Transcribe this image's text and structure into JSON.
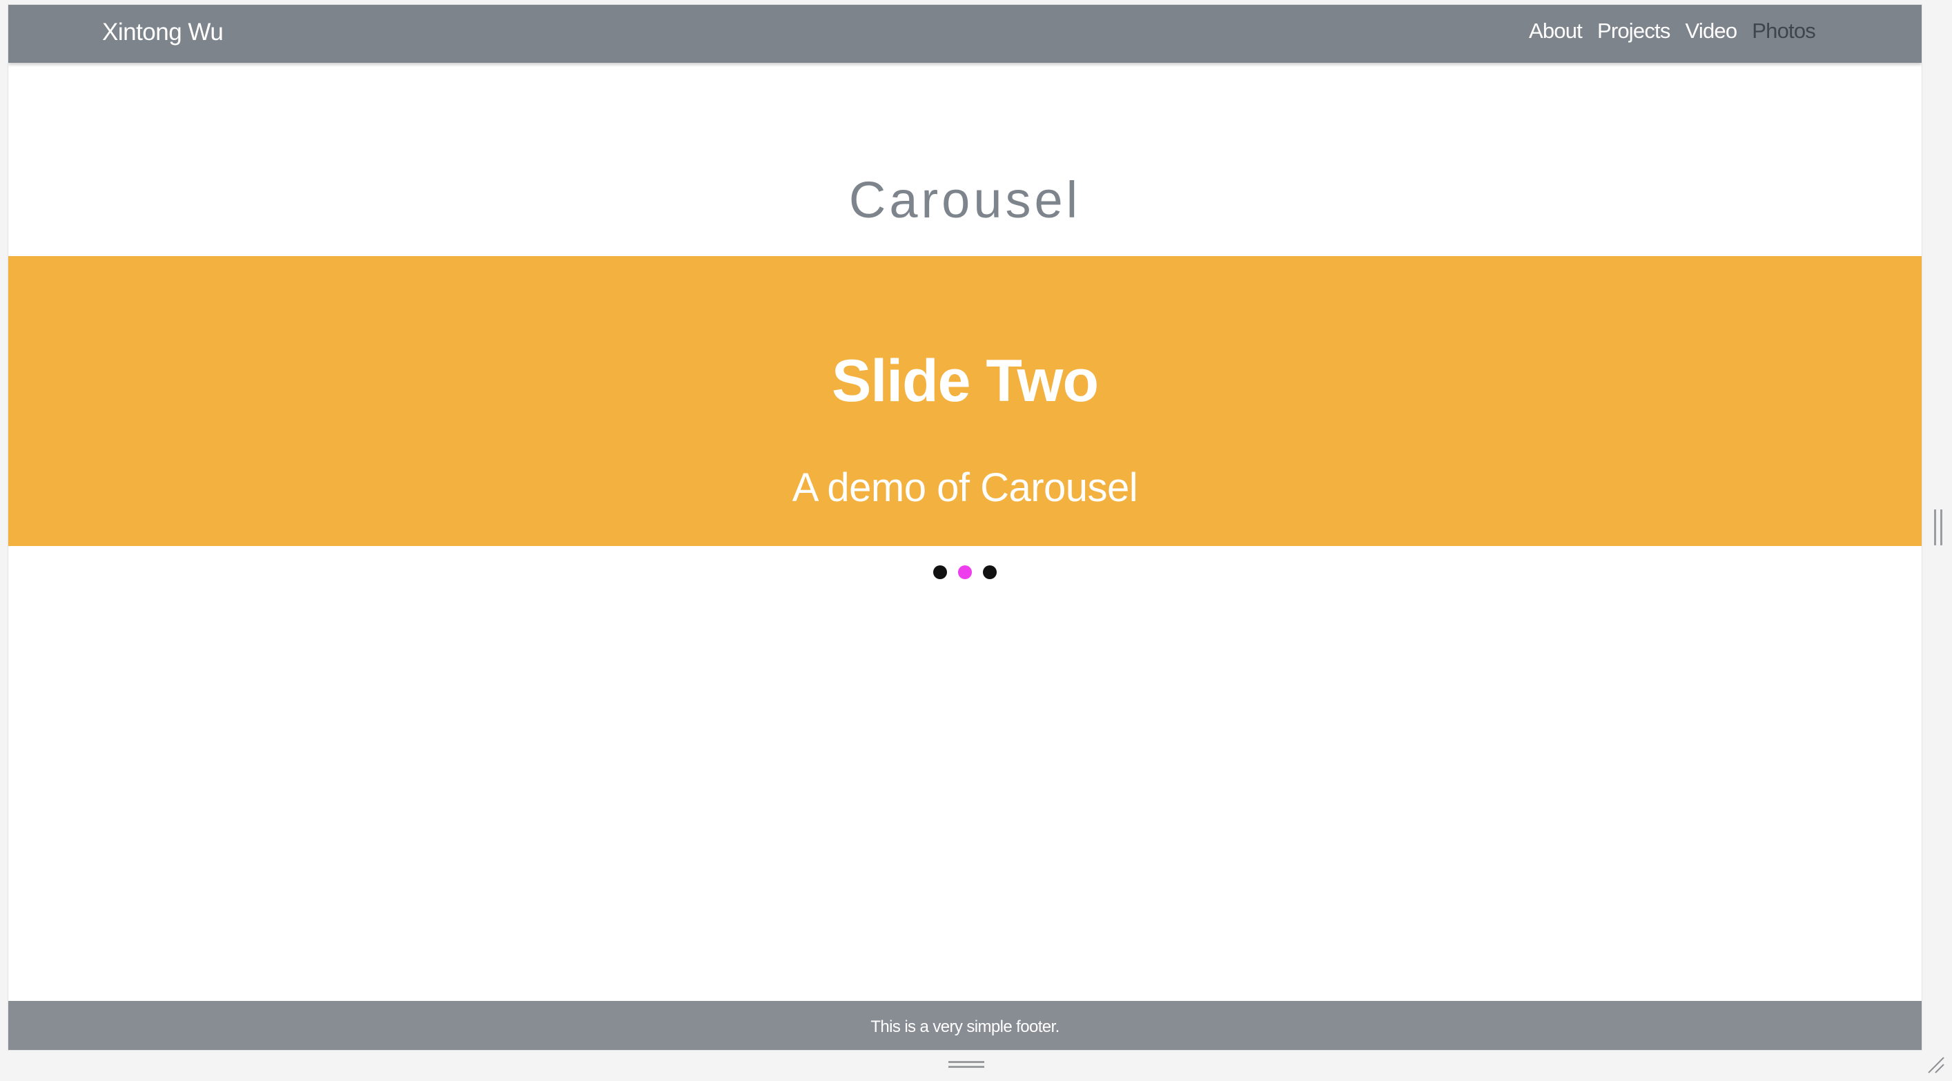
{
  "navbar": {
    "brand": "Xintong Wu",
    "links": [
      {
        "label": "About"
      },
      {
        "label": "Projects"
      },
      {
        "label": "Video"
      },
      {
        "label": "Photos",
        "active": true
      }
    ]
  },
  "main": {
    "title": "Carousel"
  },
  "carousel": {
    "background": "#f3b13f",
    "slide_title": "Slide Two",
    "slide_subtitle": "A demo of Carousel",
    "indicators": [
      {
        "active": false
      },
      {
        "active": true
      },
      {
        "active": false
      }
    ],
    "active_indicator_color": "#ee3ded"
  },
  "footer": {
    "text": "This is a very simple footer."
  }
}
